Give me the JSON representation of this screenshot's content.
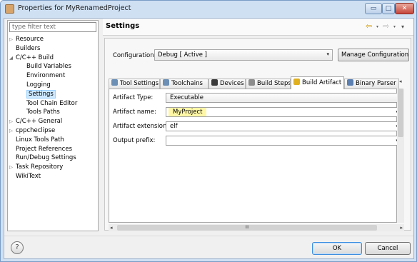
{
  "window": {
    "title": "Properties for MyRenamedProject",
    "controls": {
      "minimize": "▭",
      "maximize": "□",
      "close": "✕"
    }
  },
  "sidebar": {
    "filter_placeholder": "type filter text",
    "items": [
      {
        "label": "Resource",
        "indent": 1,
        "expander": "▷"
      },
      {
        "label": "Builders",
        "indent": 1,
        "expander": ""
      },
      {
        "label": "C/C++ Build",
        "indent": 1,
        "expander": "◢"
      },
      {
        "label": "Build Variables",
        "indent": 2,
        "expander": ""
      },
      {
        "label": "Environment",
        "indent": 2,
        "expander": ""
      },
      {
        "label": "Logging",
        "indent": 2,
        "expander": ""
      },
      {
        "label": "Settings",
        "indent": 2,
        "expander": "",
        "selected": true
      },
      {
        "label": "Tool Chain Editor",
        "indent": 2,
        "expander": ""
      },
      {
        "label": "Tools Paths",
        "indent": 2,
        "expander": ""
      },
      {
        "label": "C/C++ General",
        "indent": 1,
        "expander": "▷"
      },
      {
        "label": "cppcheclipse",
        "indent": 1,
        "expander": "▷"
      },
      {
        "label": "Linux Tools Path",
        "indent": 1,
        "expander": ""
      },
      {
        "label": "Project References",
        "indent": 1,
        "expander": ""
      },
      {
        "label": "Run/Debug Settings",
        "indent": 1,
        "expander": ""
      },
      {
        "label": "Task Repository",
        "indent": 1,
        "expander": "▷"
      },
      {
        "label": "WikiText",
        "indent": 1,
        "expander": ""
      }
    ]
  },
  "header": {
    "title": "Settings",
    "back_icon": "⇦",
    "forward_icon": "⇨",
    "caret": "▾",
    "menu_icon": "▾"
  },
  "configuration": {
    "label": "Configuration:",
    "value": "Debug  [ Active ]",
    "manage_label": "Manage Configurations..."
  },
  "tabs": [
    {
      "label": "Tool Settings",
      "icon": "tool-settings-icon",
      "color": "#6b8fb5"
    },
    {
      "label": "Toolchains",
      "icon": "toolchains-icon",
      "color": "#6b8fb5"
    },
    {
      "label": "Devices",
      "icon": "devices-icon",
      "color": "#3a3a3a"
    },
    {
      "label": "Build Steps",
      "icon": "build-steps-icon",
      "color": "#8c8c8c"
    },
    {
      "label": "Build Artifact",
      "icon": "build-artifact-icon",
      "color": "#e0b020",
      "active": true
    },
    {
      "label": "Binary Parser",
      "icon": "binary-parser-icon",
      "color": "#5a7fb0"
    }
  ],
  "artifact_form": {
    "type_label": "Artifact Type:",
    "type_value": "Executable",
    "name_label": "Artifact name:",
    "name_value": "MyProject",
    "extension_label": "Artifact extension:",
    "extension_value": "elf",
    "prefix_label": "Output prefix:",
    "prefix_value": ""
  },
  "scrollbar": {
    "grip": "III",
    "left_arrow": "◂",
    "right_arrow": "▸",
    "up_arrow": "▴",
    "down_arrow": "▾"
  },
  "footer": {
    "help_label": "?",
    "ok_label": "OK",
    "cancel_label": "Cancel"
  },
  "colors": {
    "name_highlight": "#fff7a6",
    "selected_tree_item": "#cde8ff"
  }
}
